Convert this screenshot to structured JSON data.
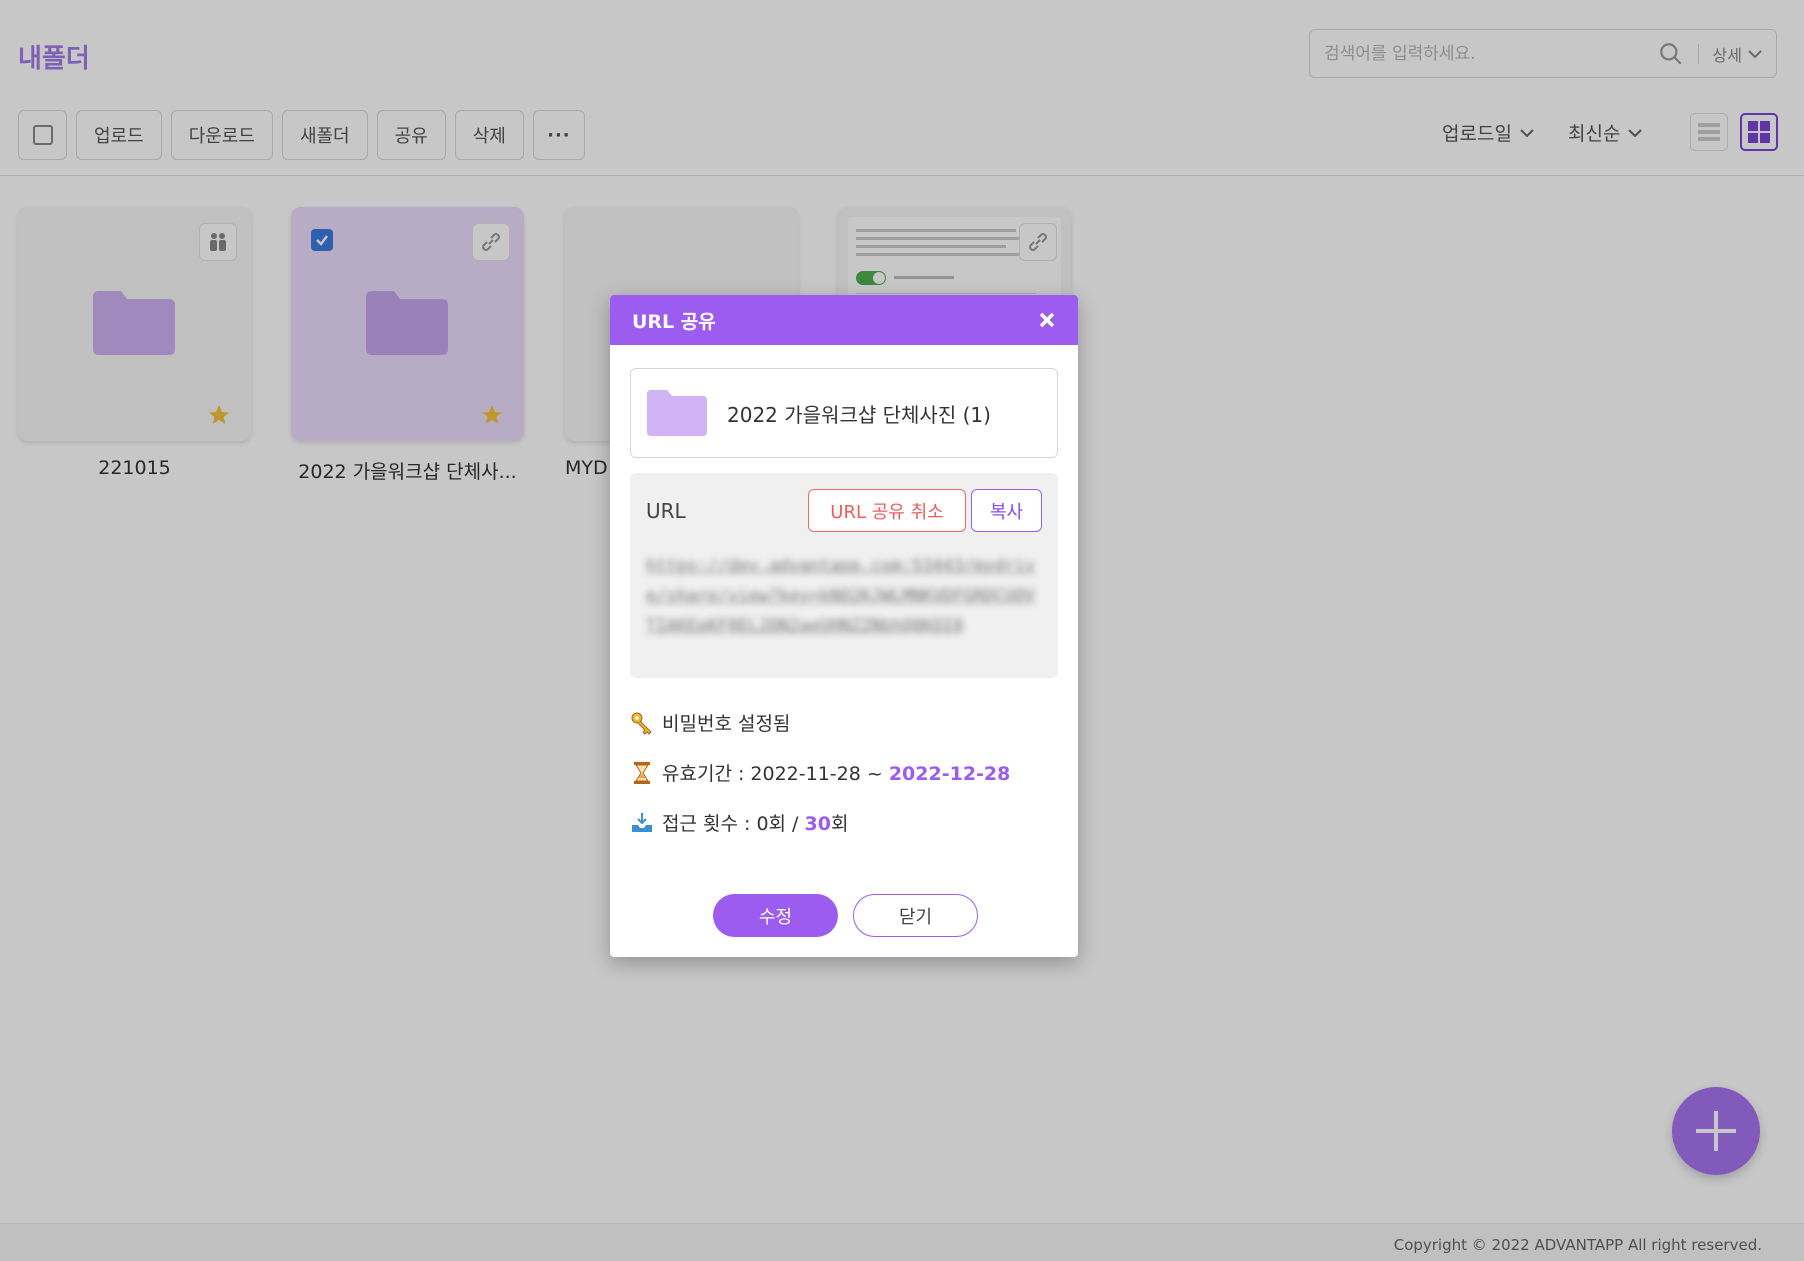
{
  "page": {
    "title": "내폴더",
    "search_placeholder": "검색어를 입력하세요.",
    "detail_label": "상세"
  },
  "toolbar": {
    "upload": "업로드",
    "download": "다운로드",
    "new_folder": "새폴더",
    "share": "공유",
    "delete": "삭제",
    "more": "···"
  },
  "sort": {
    "by": "업로드일",
    "order": "최신순"
  },
  "folders": [
    {
      "name": "221015",
      "badge": "people-icon",
      "starred": true,
      "selected": false
    },
    {
      "name": "2022 가을워크샵 단체사...",
      "badge": "link-icon",
      "starred": true,
      "selected": true
    },
    {
      "name": "MYD",
      "badge": "",
      "starred": false,
      "selected": false
    },
    {
      "name": "",
      "badge": "link-icon",
      "starred": false,
      "selected": false
    }
  ],
  "modal": {
    "title": "URL 공유",
    "file_name": "2022 가을워크샵 단체사진 (1)",
    "url_label": "URL",
    "cancel_share": "URL 공유 취소",
    "copy": "복사",
    "url": "https://dev.advantapp.com:53443/mydrive/share/view?key=kNO2KJWLMNKVDFGRDCUOVTIAKEpKF0EL2DN2aeUHNZZNbhQ8KOI0",
    "password_status": "비밀번호 설정됨",
    "period_label": "유효기간 : ",
    "period_start": "2022-11-28",
    "period_sep": " ~ ",
    "period_end": "2022-12-28",
    "access_label": "접근 횟수 : ",
    "access_used": "0회 / ",
    "access_max": "30",
    "access_unit": "회",
    "edit": "수정",
    "close": "닫기"
  },
  "footer": {
    "copyright": "Copyright © 2022 ADVANTAPP All right reserved."
  },
  "colors": {
    "accent": "#9d5cf0",
    "danger": "#f05b5b"
  }
}
